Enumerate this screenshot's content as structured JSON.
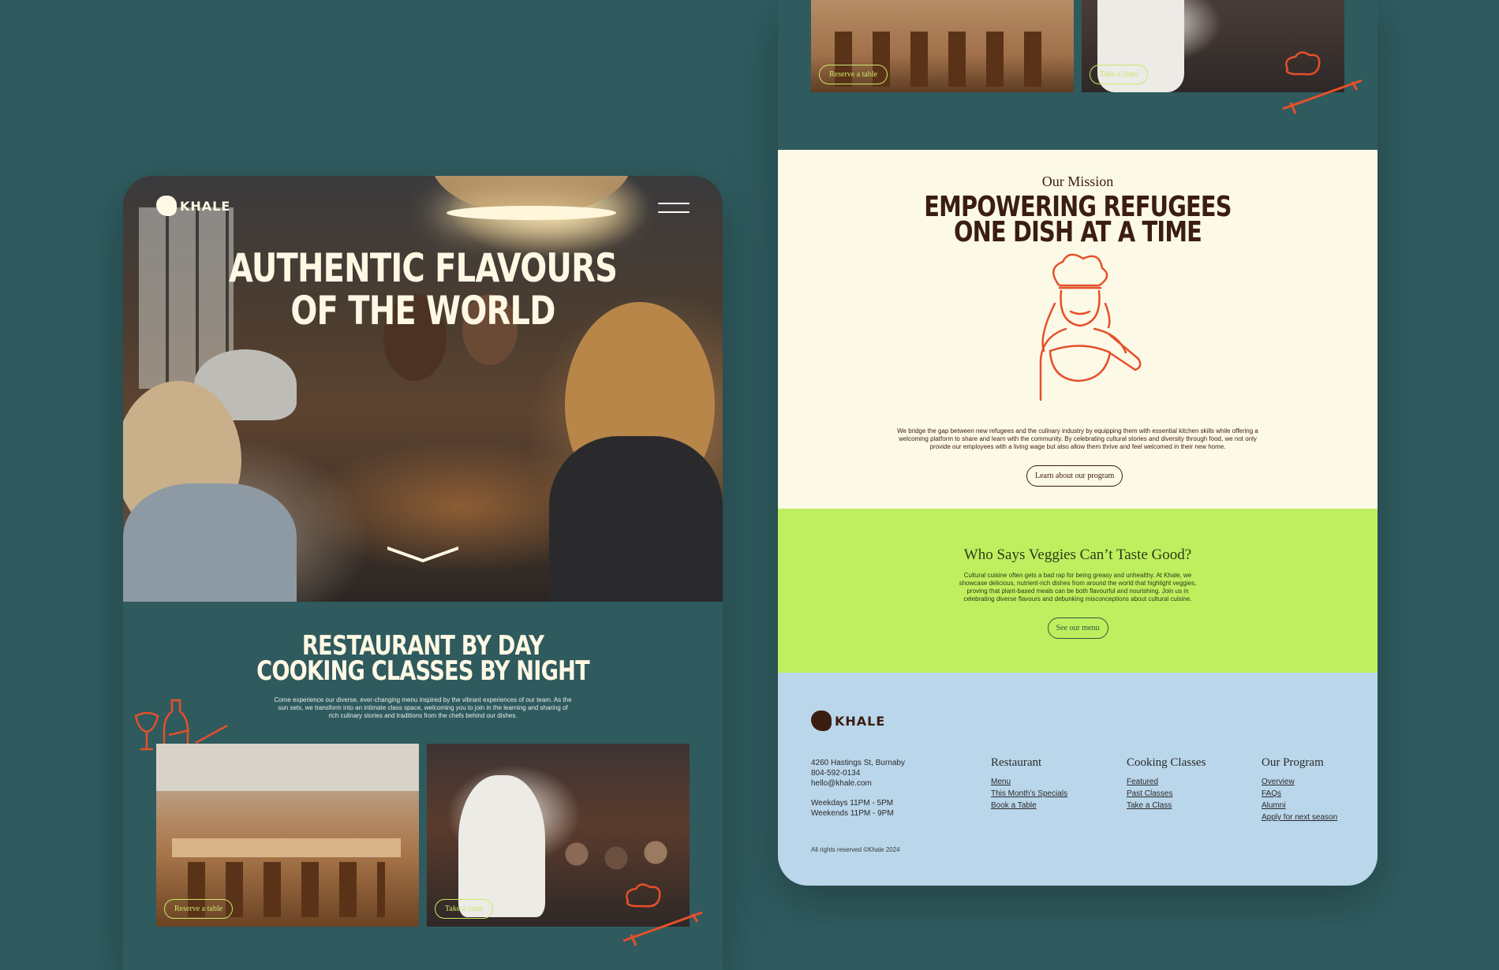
{
  "left": {
    "brand": "KHALE",
    "hero_title_line1": "AUTHENTIC FLAVOURS",
    "hero_title_line2": "OF THE WORLD",
    "section_title_line1": "RESTAURANT BY DAY",
    "section_title_line2": "COOKING CLASSES BY NIGHT",
    "section_text": "Come experience our diverse, ever-changing menu inspired by the vibrant experiences of our team. As the sun sets, we transform into an intimate class space, welcoming you to join in the learning and sharing of rich culinary stories and traditions from the chefs behind our dishes.",
    "cards": [
      {
        "cta": "Reserve a table"
      },
      {
        "cta": "Take a class"
      }
    ]
  },
  "right": {
    "cards": [
      {
        "cta": "Reserve a table"
      },
      {
        "cta": "Take a class"
      }
    ],
    "mission": {
      "subtitle": "Our Mission",
      "title_line1": "EMPOWERING REFUGEES",
      "title_line2": "ONE DISH AT A TIME",
      "text": "We bridge the gap between new refugees and the culinary industry by equipping them with essential kitchen skills while offering a welcoming platform to share and learn with the community. By celebrating cultural stories and diversity through food, we not only provide our employees with a living wage but also allow them thrive and feel welcomed in their new home.",
      "button": "Learn about our program"
    },
    "veggies": {
      "title": "Who Says Veggies Can’t Taste Good?",
      "text": "Cultural cuisine often gets a bad rap for being greasy and unhealthy. At Khale, we showcase delicious, nutrient-rich dishes from around the world that highlight veggies, proving that plant-based meals can be both flavourful and nourishing. Join us in celebrating diverse flavours and debunking misconceptions about cultural cuisine.",
      "button": "See our menu"
    },
    "footer": {
      "brand": "KHALE",
      "address": "4260 Hastings St, Burnaby",
      "phone": "804-592-0134",
      "email": "hello@khale.com",
      "hours_weekdays": "Weekdays 11PM - 5PM",
      "hours_weekends": "Weekends 11PM - 9PM",
      "columns": [
        {
          "heading": "Restaurant",
          "links": [
            "Menu",
            "This Month’s Specials",
            "Book a Table"
          ]
        },
        {
          "heading": "Cooking Classes",
          "links": [
            "Featured",
            "Past Classes",
            "Take a Class"
          ]
        },
        {
          "heading": "Our Program",
          "links": [
            "Overview",
            "FAQs",
            "Alumni",
            "Apply for next season"
          ]
        }
      ],
      "copyright": "All rights reserved ©Khale 2024"
    }
  },
  "colors": {
    "background": "#2f5b5f",
    "cream": "#fdf9e7",
    "brown": "#3b1d12",
    "lime": "#bfee5f",
    "footer_blue": "#bad6ea",
    "accent_orange": "#e5502a"
  },
  "icons": [
    "khale-logo-icon",
    "menu-icon",
    "chevron-down-icon",
    "wine-doodle-icon",
    "chef-hat-doodle-icon",
    "rolling-pin-doodle-icon",
    "chef-illustration-icon"
  ]
}
